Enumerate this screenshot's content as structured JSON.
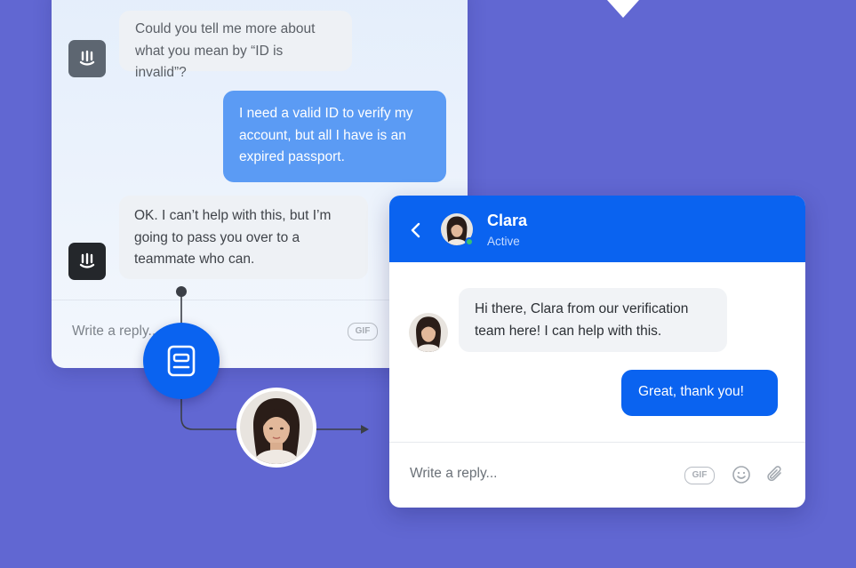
{
  "bot_chat": {
    "messages": [
      {
        "from": "bot",
        "text": "Could you tell me more about what you mean by “ID is invalid”?"
      },
      {
        "from": "user",
        "text": "I need a valid ID to verify my account, but all I have is an expired passport."
      },
      {
        "from": "bot",
        "text": "OK. I can’t help with this, but I’m going to pass you over to a teammate who can."
      }
    ],
    "reply_placeholder": "Write a reply...",
    "gif_label": "GIF"
  },
  "handoff": {
    "icon": "handoff-ticket-icon"
  },
  "agent_chat": {
    "header": {
      "name": "Clara",
      "status": "Active"
    },
    "messages": [
      {
        "from": "agent",
        "text": "Hi there, Clara from our verification team here! I can help with this."
      },
      {
        "from": "user",
        "text": "Great, thank you!"
      }
    ],
    "reply_placeholder": "Write a reply...",
    "gif_label": "GIF",
    "icons": [
      "back-icon",
      "emoji-icon",
      "attachment-icon"
    ]
  },
  "colors": {
    "background": "#6167D2",
    "brand_blue": "#0a63f0",
    "user_bubble_light": "#5b9bf4",
    "online": "#38c172"
  }
}
